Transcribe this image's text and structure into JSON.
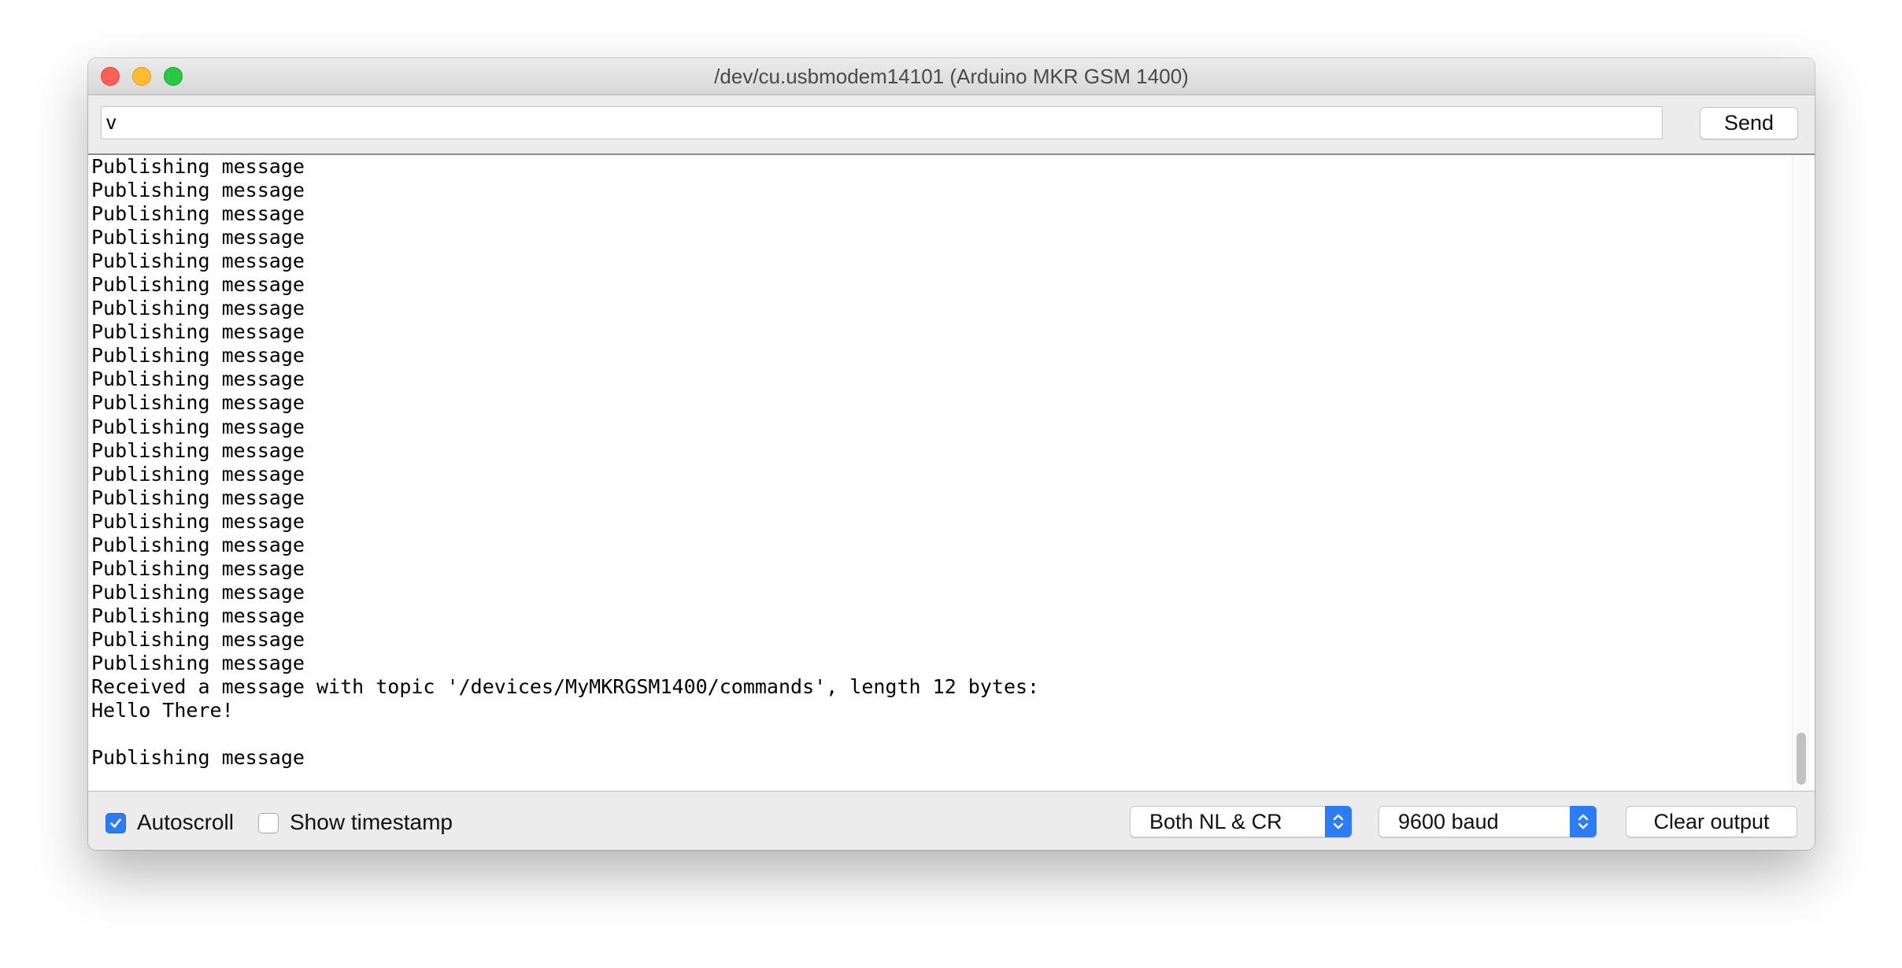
{
  "window": {
    "title": "/dev/cu.usbmodem14101 (Arduino MKR GSM 1400)"
  },
  "input": {
    "value": "v"
  },
  "send_button": {
    "label": "Send"
  },
  "output": {
    "lines": [
      "Publishing message",
      "Publishing message",
      "Publishing message",
      "Publishing message",
      "Publishing message",
      "Publishing message",
      "Publishing message",
      "Publishing message",
      "Publishing message",
      "Publishing message",
      "Publishing message",
      "Publishing message",
      "Publishing message",
      "Publishing message",
      "Publishing message",
      "Publishing message",
      "Publishing message",
      "Publishing message",
      "Publishing message",
      "Publishing message",
      "Publishing message",
      "Publishing message",
      "Received a message with topic '/devices/MyMKRGSM1400/commands', length 12 bytes:",
      "Hello There!",
      "",
      "Publishing message"
    ]
  },
  "footer": {
    "autoscroll": {
      "label": "Autoscroll",
      "checked": true
    },
    "timestamp": {
      "label": "Show timestamp",
      "checked": false
    },
    "line_ending": {
      "selected": "Both NL & CR"
    },
    "baud_rate": {
      "selected": "9600 baud"
    },
    "clear_button": {
      "label": "Clear output"
    }
  },
  "colors": {
    "accent": "#2b7cf6",
    "close": "#fe5f57",
    "minimize": "#febc2e",
    "maximize": "#28c840"
  },
  "icons": {
    "checkmark": "checkmark-icon",
    "updown": "chevron-up-down-icon"
  }
}
